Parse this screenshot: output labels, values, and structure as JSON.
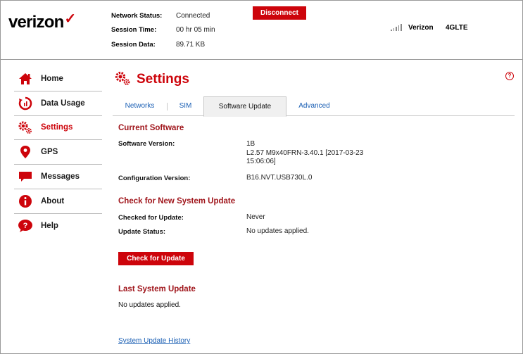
{
  "brand": {
    "logo_text": "verizon",
    "logo_mark": "✓",
    "accent": "#cd040b"
  },
  "header": {
    "network_status_label": "Network Status:",
    "network_status_value": "Connected",
    "session_time_label": "Session Time:",
    "session_time_value": "00 hr 05 min",
    "session_data_label": "Session Data:",
    "session_data_value": "89.71 KB",
    "disconnect_label": "Disconnect",
    "carrier": "Verizon",
    "network_type": "4GLTE"
  },
  "sidebar": {
    "items": [
      {
        "label": "Home",
        "icon": "home-icon"
      },
      {
        "label": "Data Usage",
        "icon": "data-usage-icon"
      },
      {
        "label": "Settings",
        "icon": "settings-gears-icon",
        "active": true
      },
      {
        "label": "GPS",
        "icon": "map-pin-icon"
      },
      {
        "label": "Messages",
        "icon": "message-icon"
      },
      {
        "label": "About",
        "icon": "info-icon"
      },
      {
        "label": "Help",
        "icon": "help-bubble-icon"
      }
    ]
  },
  "page": {
    "title": "Settings",
    "help_glyph": "?",
    "tabs": [
      {
        "label": "Networks"
      },
      {
        "label": "SIM"
      },
      {
        "label": "Software Update",
        "active": true
      },
      {
        "label": "Advanced"
      }
    ]
  },
  "current_software": {
    "title": "Current Software",
    "software_version_label": "Software Version:",
    "software_version_lines": [
      "1B",
      "L2.57 M9x40FRN-3.40.1 [2017-03-23",
      "15:06:06]"
    ],
    "config_version_label": "Configuration Version:",
    "config_version_value": "B16.NVT.USB730L.0"
  },
  "check_update": {
    "title": "Check for New System Update",
    "checked_label": "Checked for Update:",
    "checked_value": "Never",
    "status_label": "Update Status:",
    "status_value": "No updates applied.",
    "button_label": "Check for Update"
  },
  "last_update": {
    "title": "Last System Update",
    "text": "No updates applied.",
    "history_link": "System Update History"
  }
}
